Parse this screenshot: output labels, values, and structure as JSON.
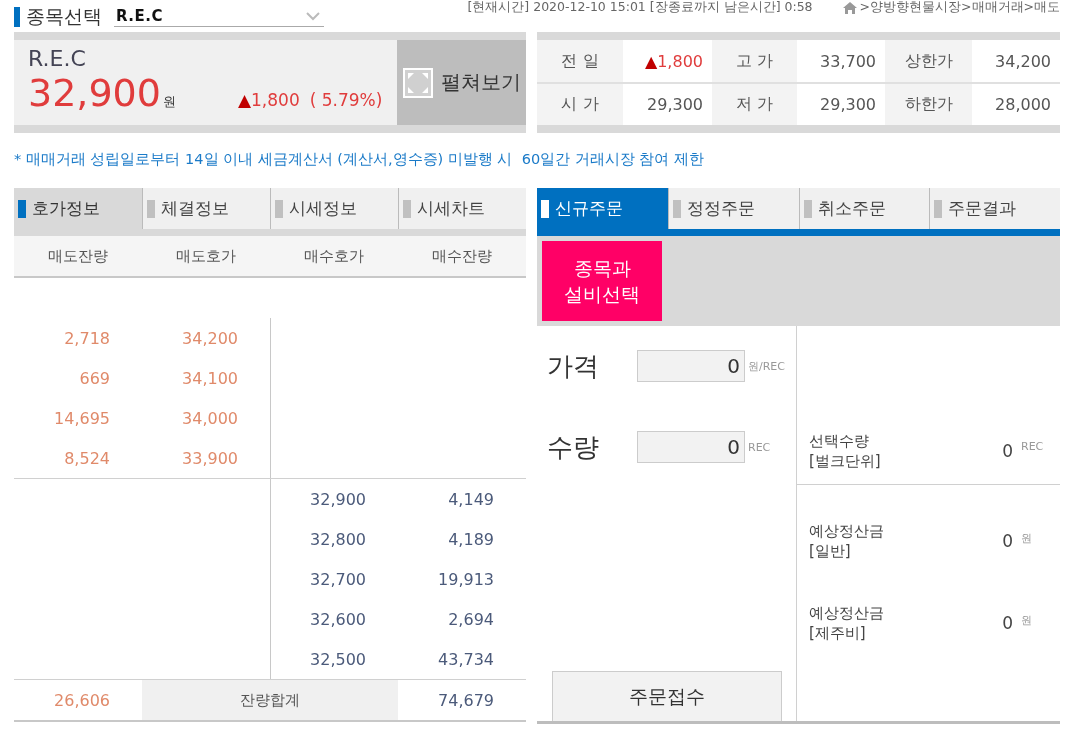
{
  "header": {
    "title": "종목선택",
    "stock_select": {
      "value": "R.E.C"
    },
    "clock": "[현재시간] 2020-12-10 15:01 [장종료까지 남은시간] 0:58",
    "breadcrumb": ">양방향현물시장>매매거래>매도"
  },
  "quote": {
    "name": "R.E.C",
    "price": "32,900",
    "unit": "원",
    "kind": "up",
    "arrow": "▲",
    "change": "1,800",
    "percent": "( 5.79%)",
    "expand_button": "펼쳐보기"
  },
  "summary": [
    [
      {
        "label": "전 일",
        "value": "1,800",
        "kind": "up",
        "arrow": "▲"
      },
      {
        "label": "고 가",
        "value": "33,700",
        "kind": "plain"
      },
      {
        "label": "상한가",
        "value": "34,200",
        "kind": "plain"
      }
    ],
    [
      {
        "label": "시 가",
        "value": "29,300",
        "kind": "plain"
      },
      {
        "label": "저 가",
        "value": "29,300",
        "kind": "plain"
      },
      {
        "label": "하한가",
        "value": "28,000",
        "kind": "plain"
      }
    ]
  ],
  "notice": "* 매매거래 성립일로부터 14일 이내 세금계산서 (계산서,영수증) 미발행 시  60일간 거래시장 참여 제한",
  "info_tabs": [
    {
      "label": "호가정보",
      "selected": true
    },
    {
      "label": "체결정보",
      "selected": false
    },
    {
      "label": "시세정보",
      "selected": false
    },
    {
      "label": "시세차트",
      "selected": false
    }
  ],
  "orderbook": {
    "columns": [
      "매도잔량",
      "매도호가",
      "매수호가",
      "매수잔량"
    ],
    "asks": [
      {
        "volume": "2,718",
        "price": "34,200"
      },
      {
        "volume": "669",
        "price": "34,100"
      },
      {
        "volume": "14,695",
        "price": "34,000"
      },
      {
        "volume": "8,524",
        "price": "33,900"
      }
    ],
    "bids": [
      {
        "price": "32,900",
        "volume": "4,149"
      },
      {
        "price": "32,800",
        "volume": "4,189"
      },
      {
        "price": "32,700",
        "volume": "19,913"
      },
      {
        "price": "32,600",
        "volume": "2,694"
      },
      {
        "price": "32,500",
        "volume": "43,734"
      }
    ],
    "totals": {
      "ask_total": "26,606",
      "label": "잔량합계",
      "bid_total": "74,679"
    }
  },
  "order_tabs": [
    {
      "label": "신규주문",
      "selected": true
    },
    {
      "label": "정정주문",
      "selected": false
    },
    {
      "label": "취소주문",
      "selected": false
    },
    {
      "label": "주문결과",
      "selected": false
    }
  ],
  "order": {
    "select_button": "종목과\n설비선택",
    "fields": [
      {
        "label": "가격",
        "value": "0",
        "unit": "원/REC"
      },
      {
        "label": "수량",
        "value": "0",
        "unit": "REC"
      }
    ],
    "submit_button": "주문접수",
    "stats": [
      {
        "label": "선택수량\n[벌크단위]",
        "value": "0",
        "unit": "REC"
      },
      {
        "label": "예상정산금\n[일반]",
        "value": "0",
        "unit": "원"
      },
      {
        "label": "예상정산금\n[제주비]",
        "value": "0",
        "unit": "원"
      }
    ]
  }
}
